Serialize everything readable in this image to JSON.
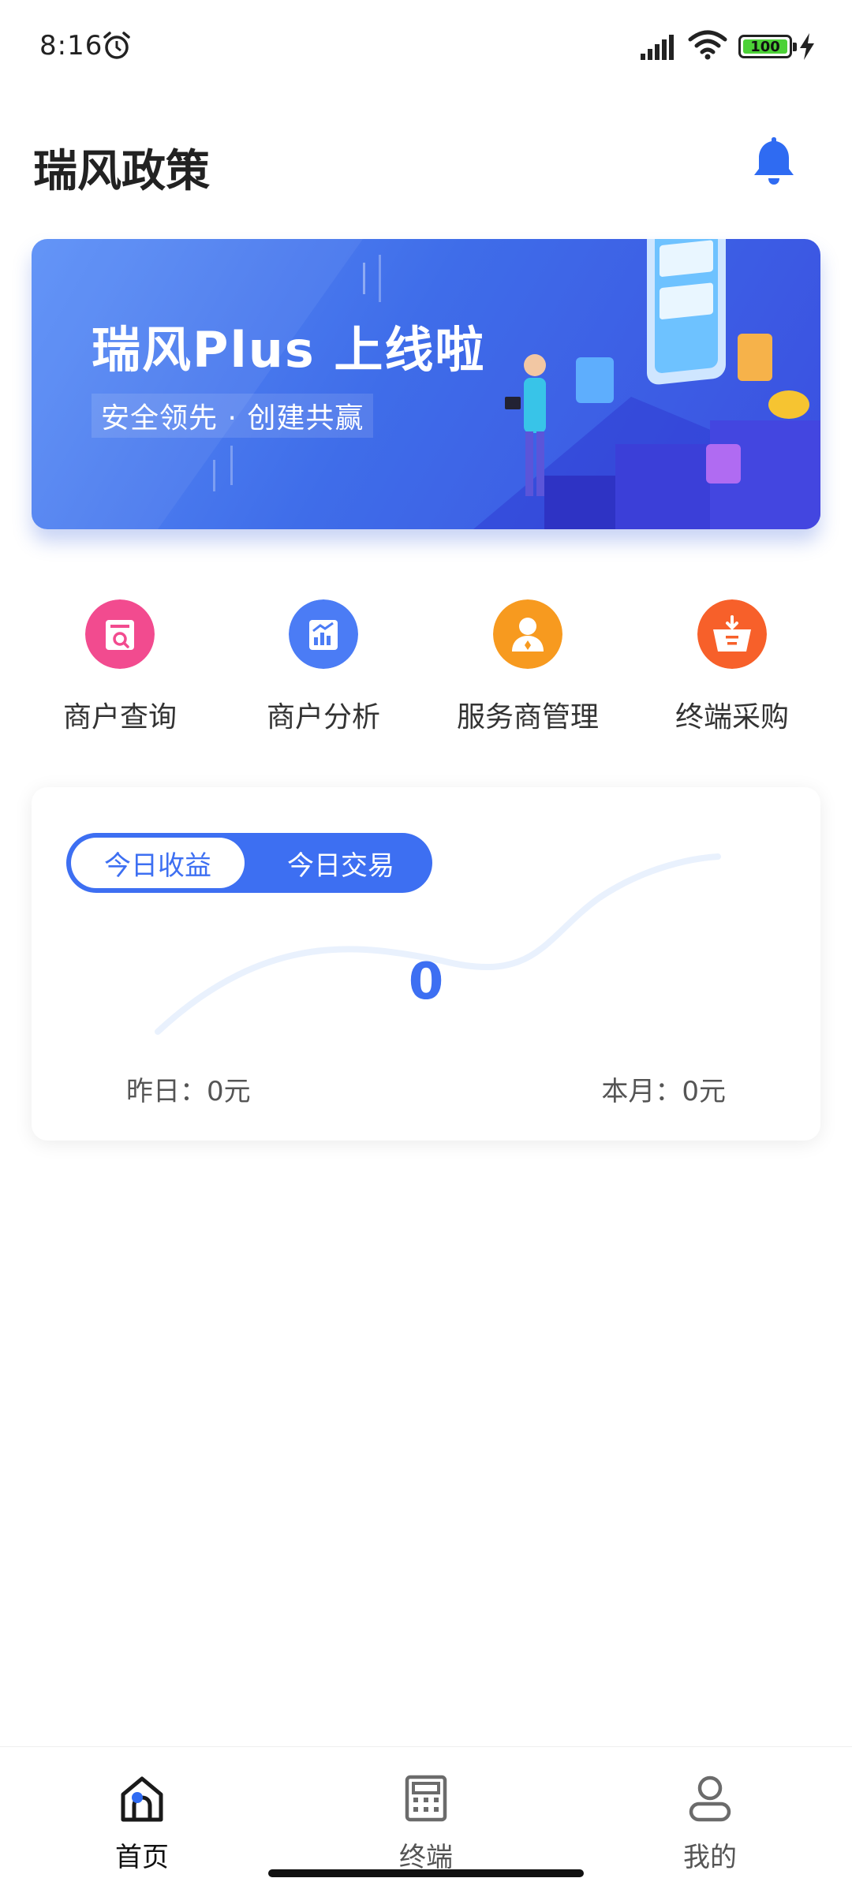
{
  "status_bar": {
    "time": "8:16",
    "battery_level": "100",
    "icons": [
      "alarm-icon",
      "signal-icon",
      "wifi-icon",
      "battery-icon",
      "charging-icon"
    ]
  },
  "header": {
    "title": "瑞风政策",
    "bell_icon": "bell-icon",
    "accent_color": "#2f6bf2"
  },
  "banner": {
    "title": "瑞风Plus 上线啦",
    "subtitle": "安全领先 · 创建共赢"
  },
  "quick_menu": [
    {
      "label": "商户查询",
      "icon": "merchant-search-icon",
      "color": "#f24b8f"
    },
    {
      "label": "商户分析",
      "icon": "merchant-analysis-icon",
      "color": "#4b7cf5"
    },
    {
      "label": "服务商管理",
      "icon": "provider-management-icon",
      "color": "#f79a1f"
    },
    {
      "label": "终端采购",
      "icon": "terminal-purchase-icon",
      "color": "#f7602a"
    }
  ],
  "earnings": {
    "tabs": [
      {
        "label": "今日收益",
        "active": true
      },
      {
        "label": "今日交易",
        "active": false
      }
    ],
    "value": "0",
    "yesterday": "昨日：0元",
    "this_month": "本月：0元"
  },
  "bottom_nav": [
    {
      "label": "首页",
      "icon": "home-icon",
      "active": true
    },
    {
      "label": "终端",
      "icon": "terminal-icon",
      "active": false
    },
    {
      "label": "我的",
      "icon": "profile-icon",
      "active": false
    }
  ]
}
